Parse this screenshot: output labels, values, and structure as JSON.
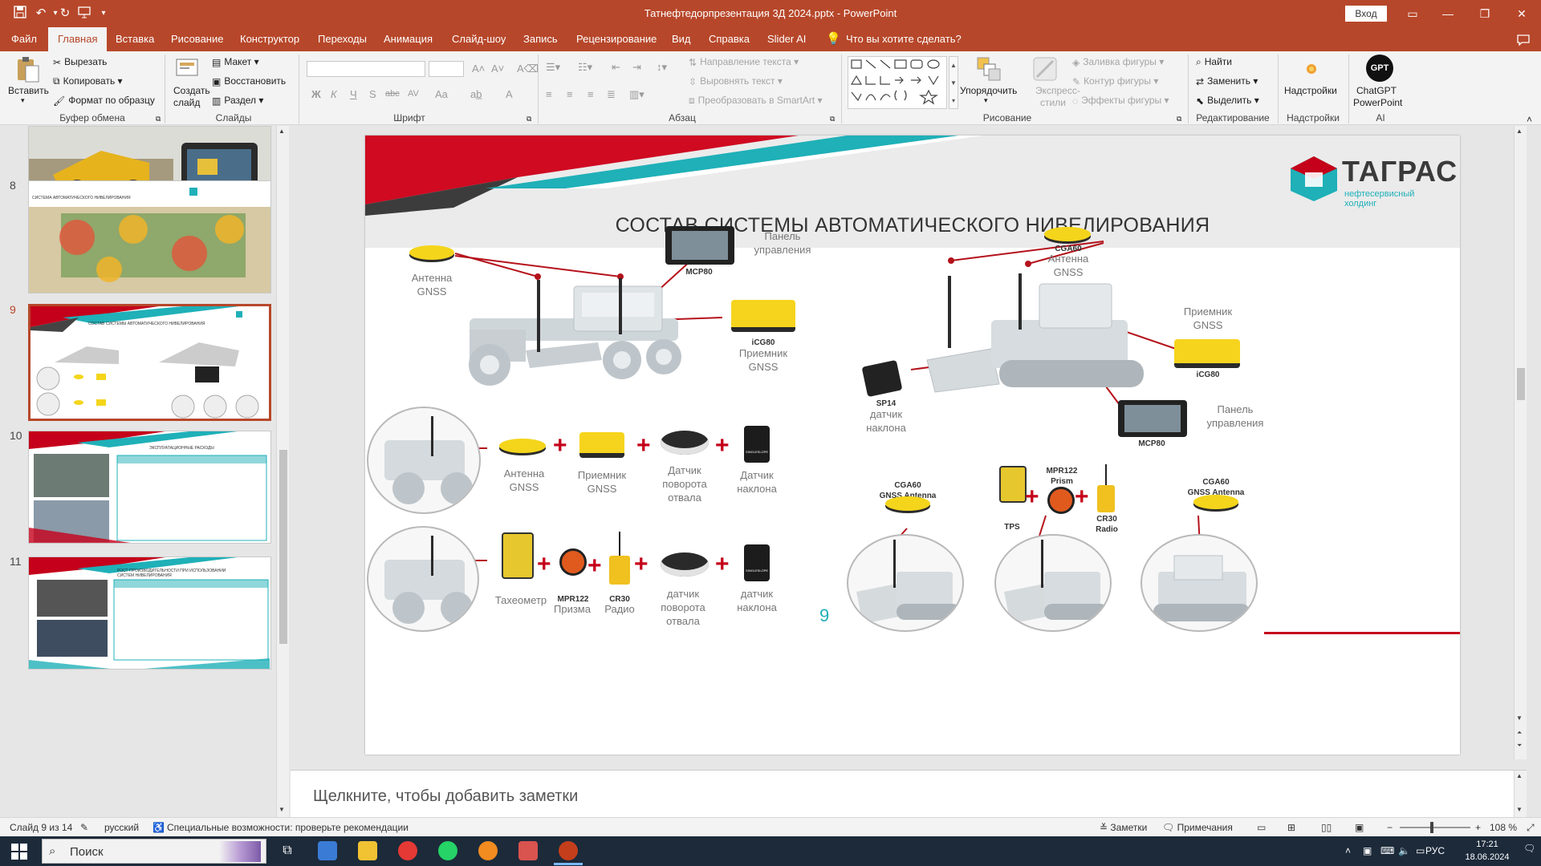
{
  "window": {
    "title": "Татнефтедорпрезентация 3Д 2024.pptx  -  PowerPoint",
    "login": "Вход"
  },
  "tabs": [
    "Файл",
    "Главная",
    "Вставка",
    "Рисование",
    "Конструктор",
    "Переходы",
    "Анимация",
    "Слайд-шоу",
    "Запись",
    "Рецензирование",
    "Вид",
    "Справка",
    "Slider AI",
    "Что вы хотите сделать?"
  ],
  "ribbon": {
    "clipboard": {
      "paste": "Вставить",
      "cut": "Вырезать",
      "copy": "Копировать",
      "format_painter": "Формат по образцу",
      "label": "Буфер обмена"
    },
    "slides": {
      "new_slide_1": "Создать",
      "new_slide_2": "слайд",
      "layout": "Макет",
      "reset": "Восстановить",
      "section": "Раздел",
      "label": "Слайды"
    },
    "font": {
      "label": "Шрифт",
      "bold": "Ж",
      "italic": "К",
      "underline": "Ч",
      "shadow": "S",
      "strike": "abc",
      "spacing": "AV",
      "case": "Aa",
      "color": "A"
    },
    "paragraph": {
      "label": "Абзац",
      "text_direction": "Направление текста",
      "align_text": "Выровнять текст",
      "smartart": "Преобразовать в SmartArt"
    },
    "drawing": {
      "label": "Рисование",
      "arrange": "Упорядочить",
      "quick_styles_1": "Экспресс-",
      "quick_styles_2": "стили",
      "shape_fill": "Заливка фигуры",
      "shape_outline": "Контур фигуры",
      "shape_effects": "Эффекты фигуры"
    },
    "editing": {
      "label": "Редактирование",
      "find": "Найти",
      "replace": "Заменить",
      "select": "Выделить"
    },
    "addins": {
      "label": "Надстройки",
      "button": "Надстройки"
    },
    "ai": {
      "label": "AI",
      "gpt_badge": "GPT",
      "chatgpt_1": "ChatGPT",
      "chatgpt_2": "PowerPoint"
    }
  },
  "thumbnails": [
    {
      "num": "8",
      "title": "СИСТЕМА АВТОМАТИЧЕСКОГО НИВЕЛИРОВАНИЯ"
    },
    {
      "num": "9",
      "title": "СОСТАВ СИСТЕМЫ АВТОМАТИЧЕСКОГО НИВЕЛИРОВАНИЯ"
    },
    {
      "num": "10",
      "title": "ЭКСПЛУАТАЦИОННЫЕ РАСХОДЫ"
    },
    {
      "num": "11",
      "title": "РОСТ ПРОИЗВОДИТЕЛЬНОСТИ ПРИ ИСПОЛЬЗОВАНИИ СИСТЕМ НИВЕЛИРОВАНИЯ"
    }
  ],
  "slide": {
    "title": "СОСТАВ СИСТЕМЫ АВТОМАТИЧЕСКОГО НИВЕЛИРОВАНИЯ",
    "logo": {
      "name": "ТАГРАС",
      "sub_1": "нефтесервисный",
      "sub_2": "холдинг"
    },
    "page_number": "9",
    "grader": {
      "antenna_1": "Антенна",
      "antenna_2": "GNSS",
      "mcp80": "MCP80",
      "panel_1": "Панель",
      "panel_2": "управления",
      "icg80": "iCG80",
      "receiver_1": "Приемник",
      "receiver_2": "GNSS"
    },
    "dozer": {
      "cga60": "CGA60",
      "antenna_1": "Антенна",
      "antenna_2": "GNSS",
      "receiver_1": "Приемник",
      "receiver_2": "GNSS",
      "icg80": "iCG80",
      "sp14": "SP14",
      "tilt_1": "датчик",
      "tilt_2": "наклона",
      "mcp80": "MCP80",
      "panel_1": "Панель",
      "panel_2": "управления"
    },
    "row1": {
      "antenna_1": "Антенна",
      "antenna_2": "GNSS",
      "receiver_1": "Приемник",
      "receiver_2": "GNSS",
      "rot_1": "Датчик",
      "rot_2": "поворота",
      "rot_3": "отвала",
      "tilt_1": "Датчик",
      "tilt_2": "наклона"
    },
    "row2": {
      "tacho": "Тахеометр",
      "prism_code": "MPR122",
      "prism": "Призма",
      "radio_code": "CR30",
      "radio": "Радио",
      "rot_1": "датчик",
      "rot_2": "поворота",
      "rot_3": "отвала",
      "tilt_1": "датчик",
      "tilt_2": "наклона"
    },
    "right_bottom": {
      "cga60_a_1": "CGA60",
      "cga60_a_2": "GNSS Antenna",
      "tps": "TPS",
      "mpr_1": "MPR122",
      "mpr_2": "Prism",
      "cr30_1": "CR30",
      "cr30_2": "Radio",
      "cga60_b_1": "CGA60",
      "cga60_b_2": "GNSS Antenna"
    },
    "sensor_text": "SINGLESLOPE"
  },
  "notes_placeholder": "Щелкните, чтобы добавить заметки",
  "status": {
    "slide_counter": "Слайд 9 из 14",
    "language": "русский",
    "accessibility": "Специальные возможности: проверьте рекомендации",
    "notes": "Заметки",
    "comments": "Примечания",
    "zoom": "108 %"
  },
  "taskbar": {
    "search": "Поиск",
    "lang": "РУС",
    "time": "17:21",
    "date": "18.06.2024"
  },
  "colors": {
    "accent": "#b7472a",
    "teal": "#1fb0b8",
    "brand_red": "#c5001a",
    "yellow": "#f4d51b"
  }
}
